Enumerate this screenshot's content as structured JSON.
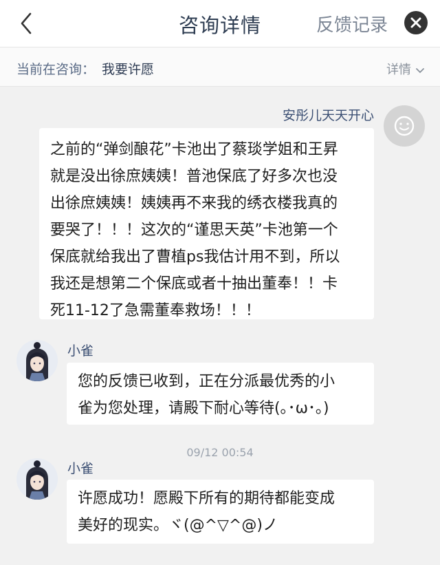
{
  "header": {
    "title": "咨询详情",
    "feedback_label": "反馈记录"
  },
  "subheader": {
    "prefix": "当前在咨询：",
    "topic": "我要许愿",
    "detail_label": "详情"
  },
  "messages": [
    {
      "sender": "安彤儿天天开心",
      "side": "right",
      "avatar_icon": "default-avatar-icon",
      "lines": [
        "之前的“弹剑酿花”卡池出了蔡琰学姐和王昇",
        "就是没出徐庶姨姨！普池保底了好多次也没",
        "出徐庶姨姨！姨姨再不来我的绣衣楼我真的",
        "要哭了！！！这次的“谨思天英”卡池第一个",
        "保底就给我出了曹植ps我估计用不到，所以",
        "我还是想第二个保底或者十抽出董奉！！卡",
        "死11-12了急需董奉救场！！！"
      ]
    },
    {
      "sender": "小雀",
      "side": "left",
      "avatar_icon": "character-avatar-icon",
      "lines": [
        "您的反馈已收到，正在分派最优秀的小",
        "雀为您处理，请殿下耐心等待(｡･ω･｡)"
      ]
    },
    {
      "sender": "小雀",
      "side": "left",
      "avatar_icon": "character-avatar-icon",
      "lines": [
        "许愿成功！愿殿下所有的期待都能变成",
        "美好的现实。ヾ(@^▽^@)ノ"
      ]
    }
  ],
  "timestamp": "09/12 00:54",
  "colors": {
    "background": "#f1f1f1",
    "bubble": "#ffffff",
    "name_text": "#3b4f73",
    "title_text": "#2e3d52"
  }
}
